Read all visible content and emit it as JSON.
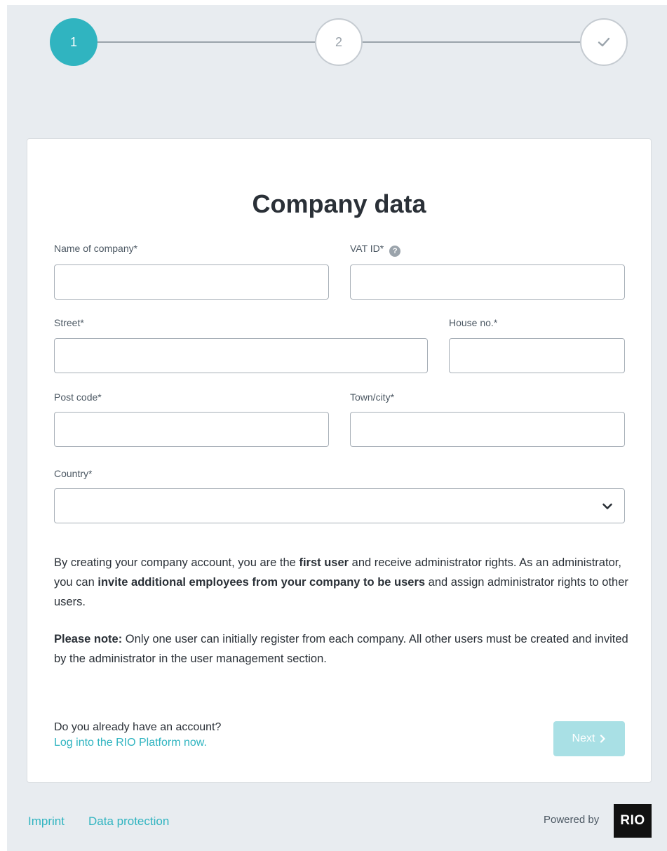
{
  "stepper": {
    "steps": [
      {
        "label": "1",
        "state": "active"
      },
      {
        "label": "2",
        "state": "inactive"
      },
      {
        "label": "",
        "state": "final",
        "icon": "check-icon"
      }
    ],
    "active_color": "#30b4c0"
  },
  "form": {
    "title": "Company data",
    "fields": {
      "company_name": {
        "label": "Name of company*",
        "value": "",
        "placeholder": ""
      },
      "vat_id": {
        "label": "VAT ID*",
        "value": "",
        "placeholder": "",
        "help_icon": "?"
      },
      "street": {
        "label": "Street*",
        "value": "",
        "placeholder": ""
      },
      "house_no": {
        "label": "House no.*",
        "value": "",
        "placeholder": ""
      },
      "post_code": {
        "label": "Post code*",
        "value": "",
        "placeholder": ""
      },
      "town_city": {
        "label": "Town/city*",
        "value": "",
        "placeholder": ""
      },
      "country": {
        "label": "Country*",
        "selected": ""
      }
    },
    "info": {
      "p1_a": "By creating your company account, you are the ",
      "p1_b": "first user",
      "p1_c": " and receive administrator rights. As an administrator, you can ",
      "p1_d": "invite additional employees from your company to be users",
      "p1_e": " and assign administrator rights to other users.",
      "p2_a": "Please note:",
      "p2_b": " Only one user can initially register from each company. All other users must be created and invited by the administrator in the user management section."
    },
    "account_question": "Do you already have an account?",
    "login_link": "Log into the RIO Platform now.",
    "next_label": "Next"
  },
  "footer": {
    "imprint": "Imprint",
    "data_protection": "Data protection",
    "powered_by": "Powered by",
    "logo_text": "RIO"
  }
}
